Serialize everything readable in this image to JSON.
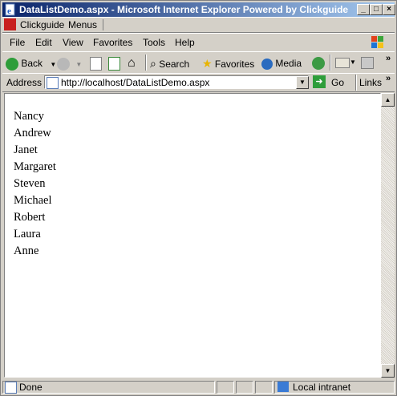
{
  "window": {
    "title": "DataListDemo.aspx - Microsoft Internet Explorer Powered by Clickguide",
    "controls": [
      "_",
      "□",
      "×"
    ]
  },
  "clickguide_bar": {
    "brand": "Clickguide",
    "menus": "Menus"
  },
  "menubar": {
    "items": [
      "File",
      "Edit",
      "View",
      "Favorites",
      "Tools",
      "Help"
    ]
  },
  "toolbar": {
    "back": "Back",
    "search": "Search",
    "favorites": "Favorites",
    "media": "Media"
  },
  "address_bar": {
    "label": "Address",
    "url": "http://localhost/DataListDemo.aspx",
    "go": "Go",
    "links": "Links"
  },
  "page": {
    "names": [
      "Nancy",
      "Andrew",
      "Janet",
      "Margaret",
      "Steven",
      "Michael",
      "Robert",
      "Laura",
      "Anne"
    ]
  },
  "statusbar": {
    "status": "Done",
    "zone": "Local intranet"
  },
  "colors": {
    "titlebar_start": "#0a246a",
    "titlebar_end": "#a6caf0",
    "chrome": "#d4d0c8"
  }
}
